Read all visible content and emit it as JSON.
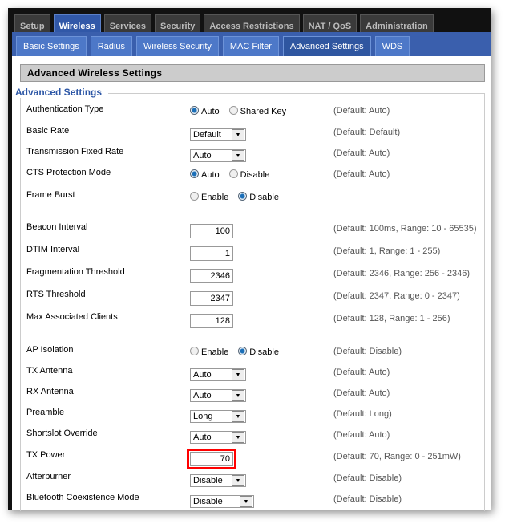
{
  "main_tabs": [
    {
      "label": "Setup"
    },
    {
      "label": "Wireless",
      "active": true
    },
    {
      "label": "Services"
    },
    {
      "label": "Security"
    },
    {
      "label": "Access Restrictions"
    },
    {
      "label": "NAT / QoS"
    },
    {
      "label": "Administration"
    }
  ],
  "sub_tabs": [
    {
      "label": "Basic Settings"
    },
    {
      "label": "Radius"
    },
    {
      "label": "Wireless Security"
    },
    {
      "label": "MAC Filter"
    },
    {
      "label": "Advanced Settings",
      "active": true
    },
    {
      "label": "WDS"
    }
  ],
  "header": "Advanced Wireless Settings",
  "legend": "Advanced Settings",
  "rows": [
    {
      "label": "Authentication Type",
      "type": "radio",
      "options": [
        "Auto",
        "Shared Key"
      ],
      "selected": 0,
      "default": "(Default: Auto)"
    },
    {
      "label": "Basic Rate",
      "type": "select",
      "value": "Default",
      "default": "(Default: Default)"
    },
    {
      "label": "Transmission Fixed Rate",
      "type": "select",
      "value": "Auto",
      "default": "(Default: Auto)"
    },
    {
      "label": "CTS Protection Mode",
      "type": "radio",
      "options": [
        "Auto",
        "Disable"
      ],
      "selected": 0,
      "default": "(Default: Auto)"
    },
    {
      "label": "Frame Burst",
      "type": "radio",
      "options": [
        "Enable",
        "Disable"
      ],
      "selected": 1,
      "default": ""
    },
    {
      "label": "Beacon Interval",
      "type": "input",
      "value": "100",
      "default": "(Default: 100ms, Range: 10 - 65535)"
    },
    {
      "label": "DTIM Interval",
      "type": "input",
      "value": "1",
      "default": "(Default: 1, Range: 1 - 255)"
    },
    {
      "label": "Fragmentation Threshold",
      "type": "input",
      "value": "2346",
      "default": "(Default: 2346, Range: 256 - 2346)"
    },
    {
      "label": "RTS Threshold",
      "type": "input",
      "value": "2347",
      "default": "(Default: 2347, Range: 0 - 2347)"
    },
    {
      "label": "Max Associated Clients",
      "type": "input",
      "value": "128",
      "default": "(Default: 128, Range: 1 - 256)"
    },
    {
      "label": "AP Isolation",
      "type": "radio",
      "options": [
        "Enable",
        "Disable"
      ],
      "selected": 1,
      "default": "(Default: Disable)"
    },
    {
      "label": "TX Antenna",
      "type": "select",
      "value": "Auto",
      "default": "(Default: Auto)"
    },
    {
      "label": "RX Antenna",
      "type": "select",
      "value": "Auto",
      "default": "(Default: Auto)"
    },
    {
      "label": "Preamble",
      "type": "select",
      "value": "Long",
      "default": "(Default: Long)"
    },
    {
      "label": "Shortslot Override",
      "type": "select",
      "value": "Auto",
      "default": "(Default: Auto)"
    },
    {
      "label": "TX Power",
      "type": "input",
      "value": "70",
      "highlight": true,
      "default": "(Default: 70, Range: 0 - 251mW)"
    },
    {
      "label": "Afterburner",
      "type": "select",
      "value": "Disable",
      "default": "(Default: Disable)"
    },
    {
      "label": "Bluetooth Coexistence Mode",
      "type": "select",
      "value": "Disable",
      "wide": true,
      "default": "(Default: Disable)"
    }
  ]
}
